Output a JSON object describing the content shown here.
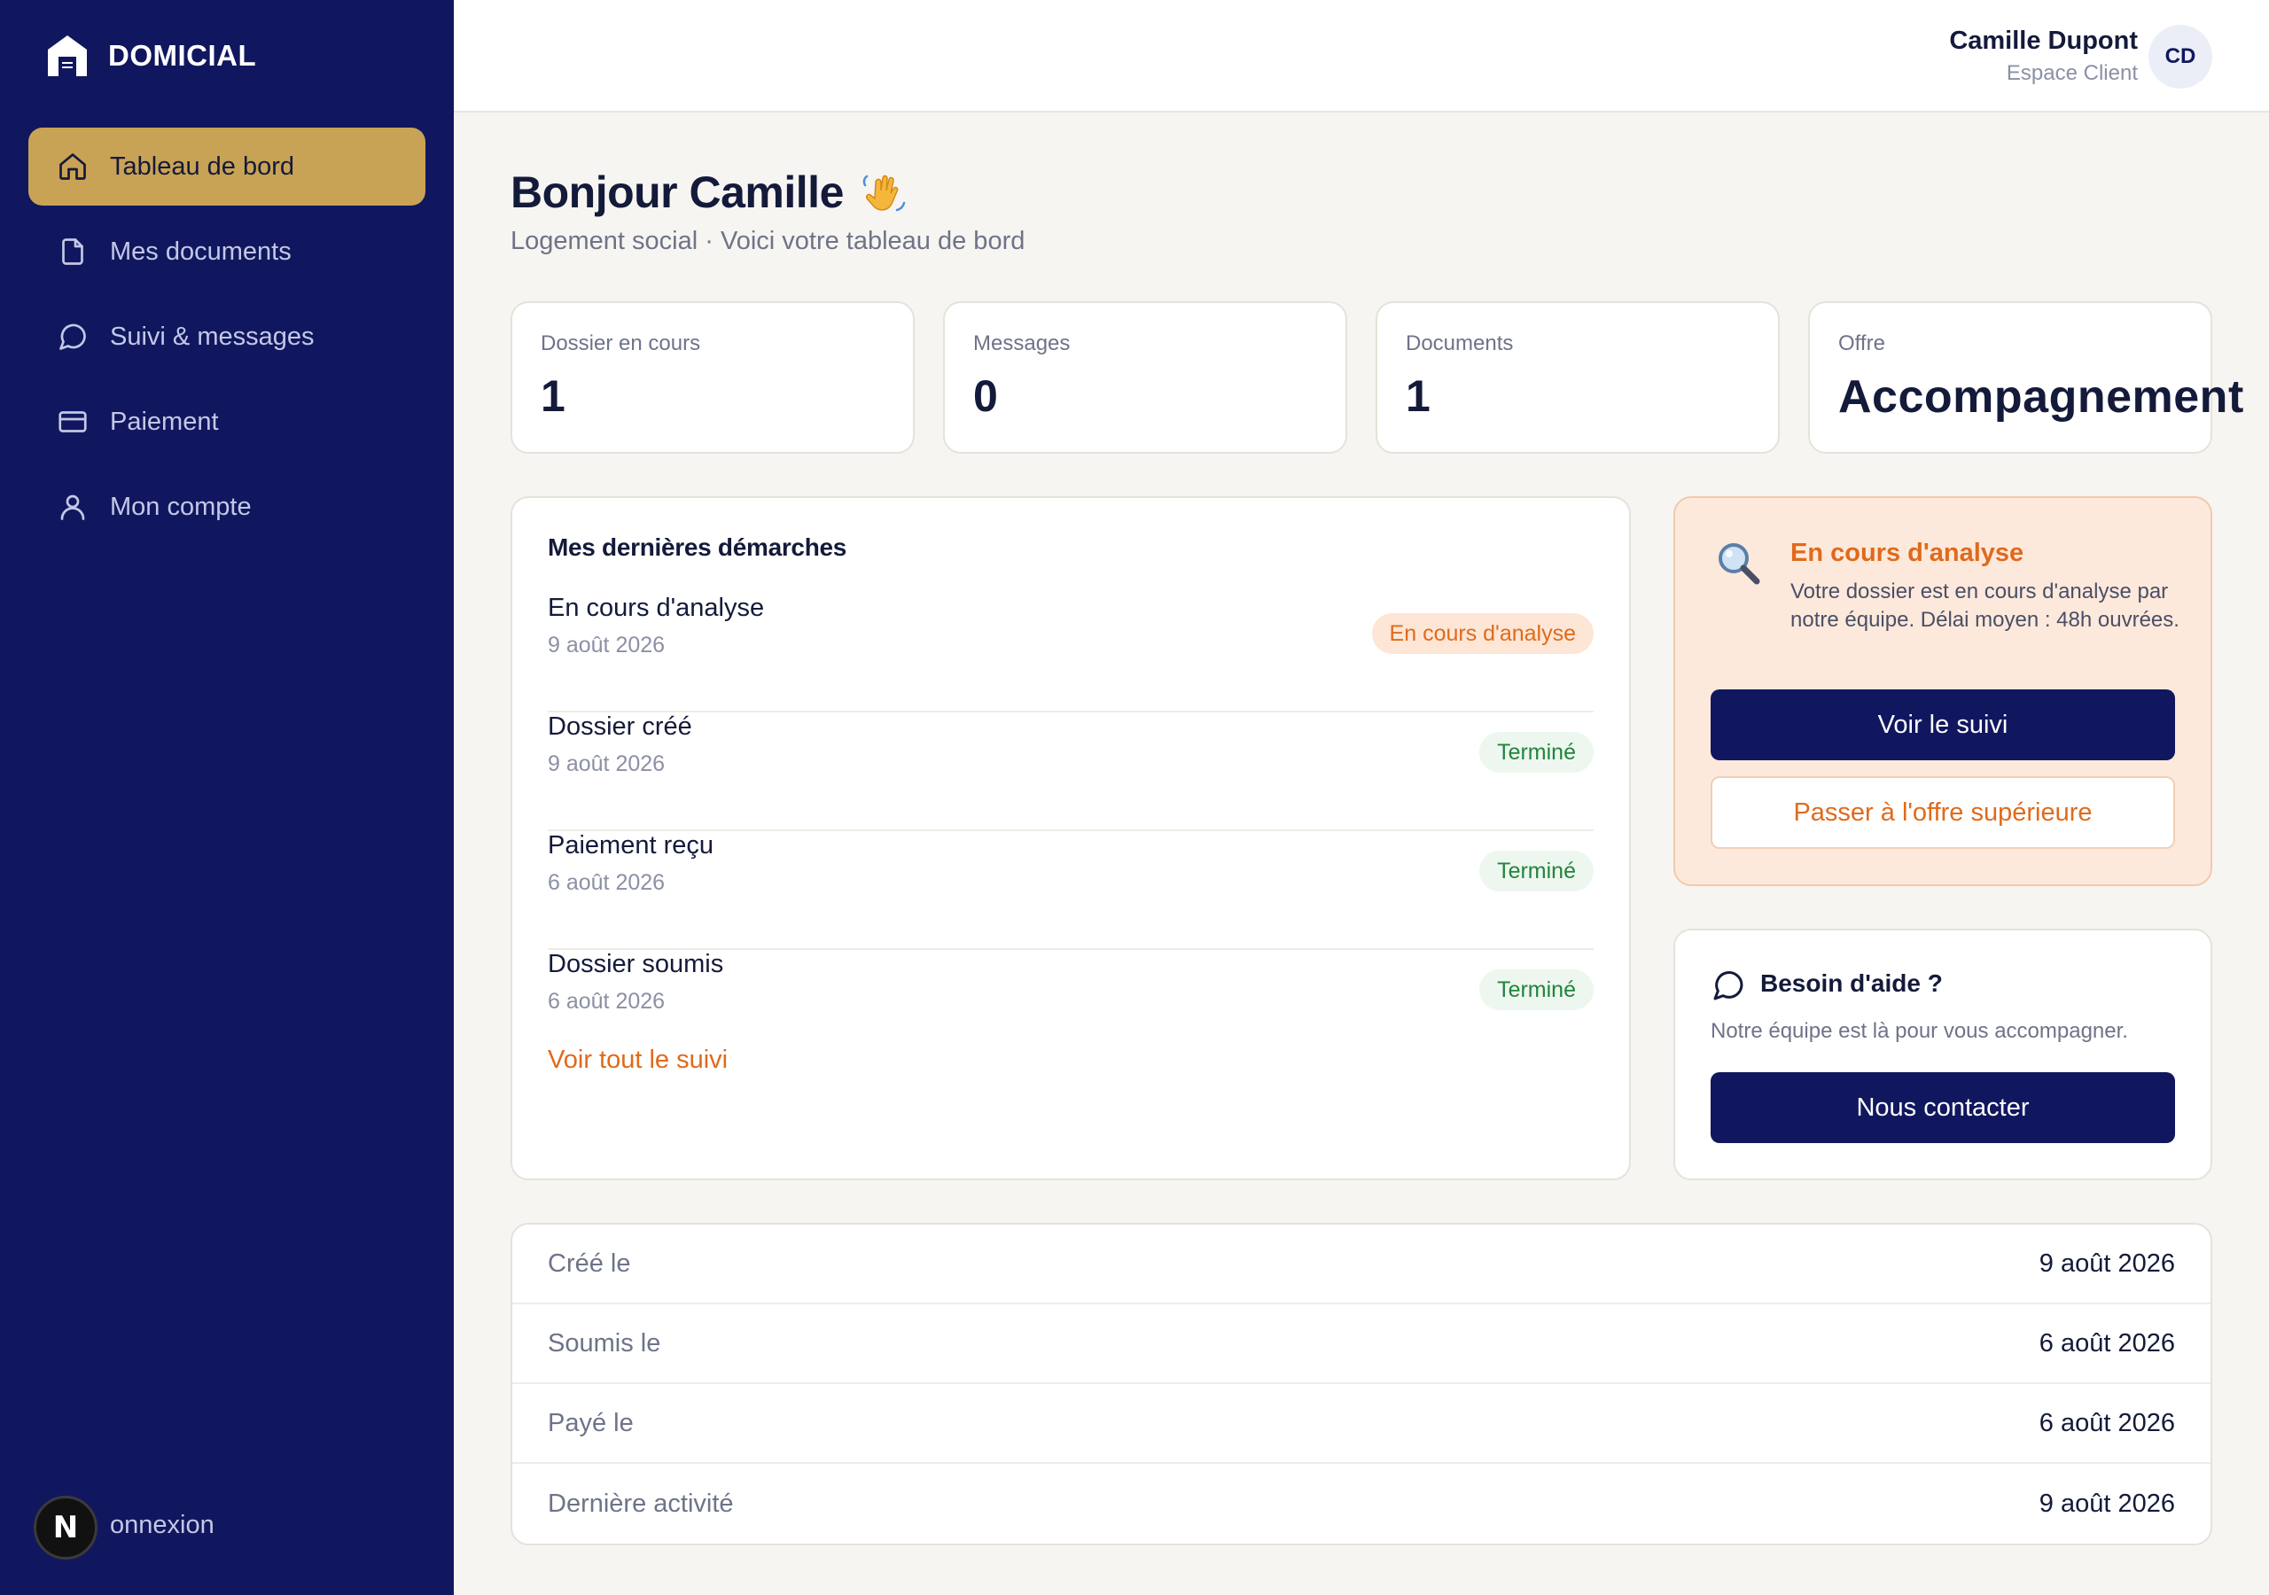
{
  "brand": {
    "name": "DOMICIAL"
  },
  "sidebar": {
    "items": [
      {
        "label": "Tableau de bord",
        "icon": "home-icon",
        "active": true
      },
      {
        "label": "Mes documents",
        "icon": "document-icon"
      },
      {
        "label": "Suivi & messages",
        "icon": "chat-bubble-icon"
      },
      {
        "label": "Paiement",
        "icon": "credit-card-icon"
      },
      {
        "label": "Mon compte",
        "icon": "user-icon"
      }
    ],
    "logout_label": "onnexion",
    "dev_badge": "N"
  },
  "header": {
    "user_name": "Camille Dupont",
    "user_role": "Espace Client",
    "avatar_initials": "CD"
  },
  "main": {
    "greeting": "Bonjour Camille",
    "subtitle": "Logement social · Voici votre tableau de bord",
    "stats": [
      {
        "label": "Dossier en cours",
        "value": "1"
      },
      {
        "label": "Messages",
        "value": "0"
      },
      {
        "label": "Documents",
        "value": "1"
      },
      {
        "label": "Offre",
        "value": "Accompagnement"
      }
    ],
    "steps": {
      "title": "Mes dernières démarches",
      "items": [
        {
          "title": "En cours d'analyse",
          "date": "9 août 2026",
          "status": "En cours d'analyse",
          "status_color": "#e06a1b"
        },
        {
          "title": "Dossier créé",
          "date": "9 août 2026",
          "status": "Terminé",
          "status_color": "#22843a"
        },
        {
          "title": "Paiement reçu",
          "date": "6 août 2026",
          "status": "Terminé",
          "status_color": "#22843a"
        },
        {
          "title": "Dossier soumis",
          "date": "6 août 2026",
          "status": "Terminé",
          "status_color": "#22843a"
        }
      ],
      "link_label": "Voir tout le suivi"
    },
    "analysis": {
      "icon": "magnifier-icon",
      "title": "En cours d'analyse",
      "text": "Votre dossier est en cours d'analyse par notre équipe. Délai moyen : 48h ouvrées.",
      "primary_label": "Voir le suivi",
      "secondary_label": "Passer à l'offre supérieure"
    },
    "help": {
      "icon": "chat-bubble-icon",
      "title": "Besoin d'aide ?",
      "text": "Notre équipe est là pour vous accompagner.",
      "button_label": "Nous contacter"
    },
    "info": [
      {
        "label": "Créé le",
        "value": "9 août 2026"
      },
      {
        "label": "Soumis le",
        "value": "6 août 2026"
      },
      {
        "label": "Payé le",
        "value": "6 août 2026"
      },
      {
        "label": "Dernière activité",
        "value": "9 août 2026"
      }
    ]
  },
  "colors": {
    "sidebar_bg": "#11175e",
    "accent_gold": "#c9a355",
    "accent_orange": "#e06a1b",
    "success_green": "#22843a",
    "page_bg": "#f7f5f1"
  }
}
